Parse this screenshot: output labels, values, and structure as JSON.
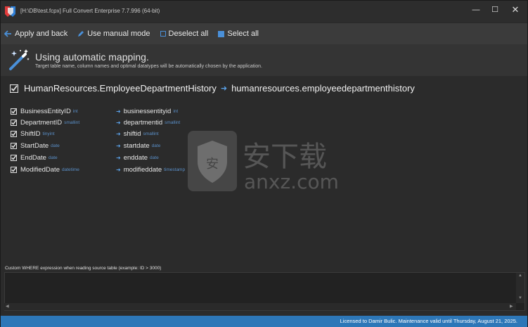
{
  "window": {
    "title": "[H:\\DB\\test.fcpx] Full Convert Enterprise 7.7.996 (64-bit)",
    "controls": {
      "minimize": "—",
      "maximize": "☐",
      "close": "✕"
    }
  },
  "toolbar": {
    "apply_label": "Apply and back",
    "manual_label": "Use manual mode",
    "deselect_label": "Deselect all",
    "select_label": "Select all"
  },
  "banner": {
    "title": "Using automatic mapping.",
    "subtitle": "Target table name, column names and optimal datatypes will be automatically chosen by the application."
  },
  "mapping": {
    "source_table": "HumanResources.EmployeeDepartmentHistory",
    "target_table": "humanresources.employeedepartmenthistory",
    "columns": [
      {
        "source": "BusinessEntityID",
        "source_type": "int",
        "target": "businessentityid",
        "target_type": "int"
      },
      {
        "source": "DepartmentID",
        "source_type": "smallint",
        "target": "departmentid",
        "target_type": "smallint"
      },
      {
        "source": "ShiftID",
        "source_type": "tinyint",
        "target": "shiftid",
        "target_type": "smallint"
      },
      {
        "source": "StartDate",
        "source_type": "date",
        "target": "startdate",
        "target_type": "date"
      },
      {
        "source": "EndDate",
        "source_type": "date",
        "target": "enddate",
        "target_type": "date"
      },
      {
        "source": "ModifiedDate",
        "source_type": "datetime",
        "target": "modifieddate",
        "target_type": "timestamp"
      }
    ]
  },
  "where": {
    "label": "Custom WHERE expression when reading source table (example: ID > 3000)",
    "value": ""
  },
  "status": {
    "text": "Licensed to Damir Bulic. Maintenance valid until Thursday, August 21, 2025."
  },
  "watermark": {
    "text": "安下载",
    "domain": "anxz.com"
  },
  "colors": {
    "accent": "#4a90d9",
    "statusbar": "#2d77b8",
    "type_label": "#5a8fc8"
  }
}
